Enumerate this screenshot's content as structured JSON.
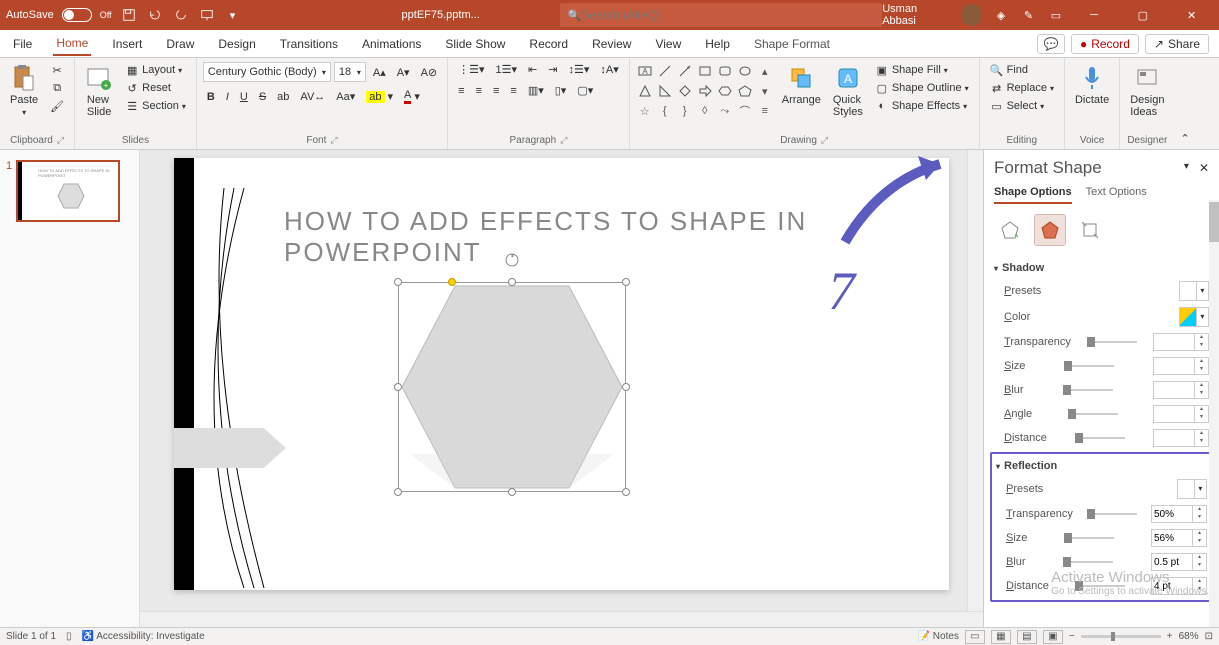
{
  "titlebar": {
    "autosave_label": "AutoSave",
    "autosave_state": "Off",
    "filename": "pptEF75.pptm...",
    "search_placeholder": "Search (Alt+Q)",
    "username": "Usman Abbasi"
  },
  "ribbon": {
    "tabs": [
      "File",
      "Home",
      "Insert",
      "Draw",
      "Design",
      "Transitions",
      "Animations",
      "Slide Show",
      "Record",
      "Review",
      "View",
      "Help",
      "Shape Format"
    ],
    "active_tab": "Home",
    "record_label": "Record",
    "share_label": "Share",
    "groups": {
      "clipboard": {
        "title": "Clipboard",
        "paste": "Paste"
      },
      "slides": {
        "title": "Slides",
        "new_slide": "New\nSlide",
        "layout": "Layout",
        "reset": "Reset",
        "section": "Section"
      },
      "font": {
        "title": "Font",
        "family": "Century Gothic (Body)",
        "size": "18"
      },
      "paragraph": {
        "title": "Paragraph"
      },
      "drawing": {
        "title": "Drawing",
        "arrange": "Arrange",
        "quick_styles": "Quick\nStyles",
        "fill": "Shape Fill",
        "outline": "Shape Outline",
        "effects": "Shape Effects"
      },
      "editing": {
        "title": "Editing",
        "find": "Find",
        "replace": "Replace",
        "select": "Select"
      },
      "voice": {
        "title": "Voice",
        "dictate": "Dictate"
      },
      "designer": {
        "title": "Designer",
        "ideas": "Design\nIdeas"
      }
    }
  },
  "slide": {
    "number": "1",
    "title_text": "HOW TO ADD EFFECTS TO SHAPE IN POWERPOINT"
  },
  "annotation": {
    "step_number": "7"
  },
  "pane": {
    "title": "Format Shape",
    "tab_shape": "Shape Options",
    "tab_text": "Text Options",
    "shadow": {
      "label": "Shadow",
      "presets": "Presets",
      "color": "Color",
      "transparency": "Transparency",
      "size": "Size",
      "blur": "Blur",
      "angle": "Angle",
      "distance": "Distance",
      "transparency_val": "",
      "size_val": "",
      "blur_val": "",
      "angle_val": "",
      "distance_val": ""
    },
    "reflection": {
      "label": "Reflection",
      "presets": "Presets",
      "transparency": "Transparency",
      "size": "Size",
      "blur": "Blur",
      "distance": "Distance",
      "transparency_val": "50%",
      "size_val": "56%",
      "blur_val": "0.5 pt",
      "distance_val": "4 pt"
    }
  },
  "watermark": {
    "line1": "Activate Windows",
    "line2": "Go to Settings to activate Windows."
  },
  "status": {
    "slide_info": "Slide 1 of 1",
    "accessibility": "Accessibility: Investigate",
    "notes": "Notes",
    "zoom": "68%"
  }
}
